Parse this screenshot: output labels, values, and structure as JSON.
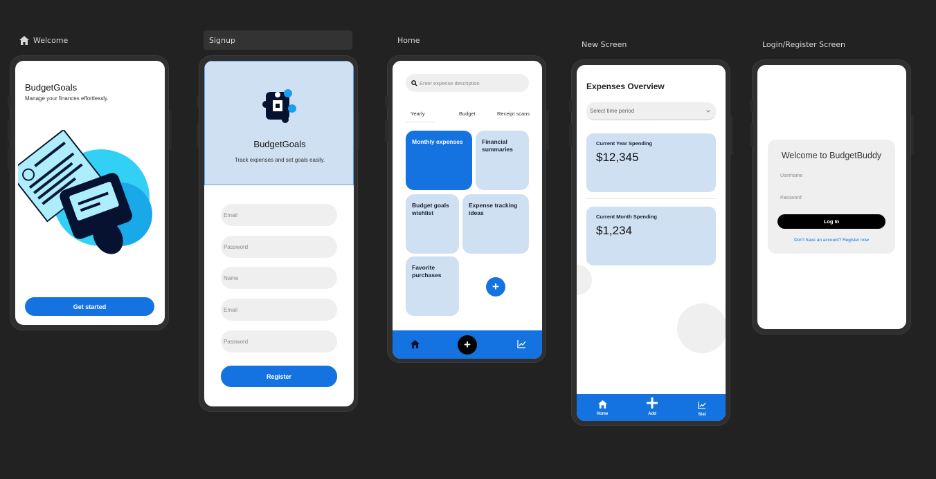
{
  "frames": {
    "welcome": {
      "label": "Welcome"
    },
    "signup": {
      "label": "Signup"
    },
    "home": {
      "label": "Home"
    },
    "new_screen": {
      "label": "New Screen"
    },
    "login": {
      "label": "Login/Register Screen"
    }
  },
  "welcome": {
    "title": "BudgetGoals",
    "subtitle": "Manage your finances effortlessly.",
    "cta": "Get started"
  },
  "signup": {
    "title": "BudgetGoals",
    "subtitle": "Track expenses and set goals easily.",
    "fields": [
      "Email",
      "Password",
      "Name",
      "Email",
      "Password"
    ],
    "register": "Register"
  },
  "home": {
    "search_placeholder": "Enter expense description",
    "tabs": [
      "Yearly",
      "Budget",
      "Receipt scans"
    ],
    "tiles": [
      "Monthly expenses",
      "Financial summaries",
      "Budget goals wishlist",
      "Expense tracking ideas",
      "Favorite purchases"
    ],
    "add_symbol": "+"
  },
  "new_screen": {
    "title": "Expenses Overview",
    "select_placeholder": "Select time period",
    "cards": [
      {
        "label": "Current Year Spending",
        "value": "$12,345"
      },
      {
        "label": "Current Month Spending",
        "value": "$1,234"
      }
    ],
    "nav": [
      "Home",
      "Add",
      "Stat"
    ]
  },
  "login": {
    "title": "Welcome to BudgetBuddy",
    "username": "Username",
    "password": "Password",
    "login_btn": "Log In",
    "register_link": "Don't have an account? Register now"
  },
  "colors": {
    "background": "#222222",
    "accent": "#1473e0",
    "tile": "#cfe0f3",
    "black_btn": "#000000"
  }
}
